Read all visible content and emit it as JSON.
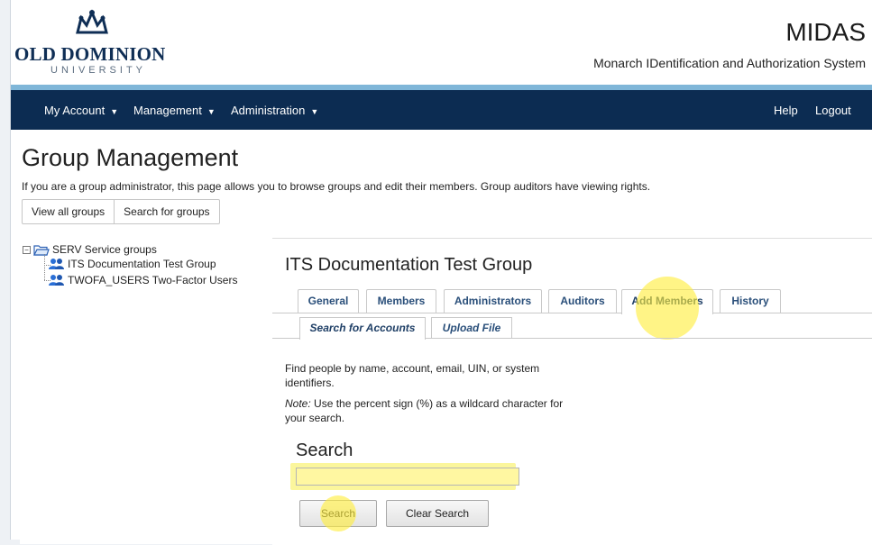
{
  "header": {
    "logo_name": "OLD DOMINION",
    "logo_sub": "UNIVERSITY",
    "app_title": "MIDAS",
    "app_subtitle": "Monarch IDentification and Authorization System"
  },
  "nav": {
    "left": [
      "My Account",
      "Management",
      "Administration"
    ],
    "right": [
      "Help",
      "Logout"
    ]
  },
  "page": {
    "title": "Group Management",
    "description": "If you are a group administrator, this page allows you to browse groups and edit their members. Group auditors have viewing rights.",
    "buttons": [
      "View all groups",
      "Search for groups"
    ]
  },
  "tree": {
    "root": "SERV Service groups",
    "children": [
      "ITS Documentation Test Group",
      "TWOFA_USERS Two-Factor Users"
    ]
  },
  "group": {
    "title": "ITS Documentation Test Group",
    "tabs": [
      "General",
      "Members",
      "Administrators",
      "Auditors",
      "Add Members",
      "History"
    ],
    "active_tab": "Add Members",
    "subtabs": [
      "Search for Accounts",
      "Upload File"
    ],
    "active_subtab": "Search for Accounts",
    "help_text": "Find people by name, account, email, UIN, or system identifiers.",
    "note_label": "Note:",
    "note_text": " Use the percent sign (%) as a wildcard character for your search.",
    "search_label": "Search",
    "search_value": "",
    "search_button": "Search",
    "clear_button": "Clear Search"
  },
  "icons": {
    "logo": "crown-icon",
    "tree_root": "folder-icon",
    "tree_child": "group-icon"
  },
  "colors": {
    "navbar": "#0c2c52",
    "accent": "#7fb6d8",
    "highlight": "#fbf69c"
  }
}
